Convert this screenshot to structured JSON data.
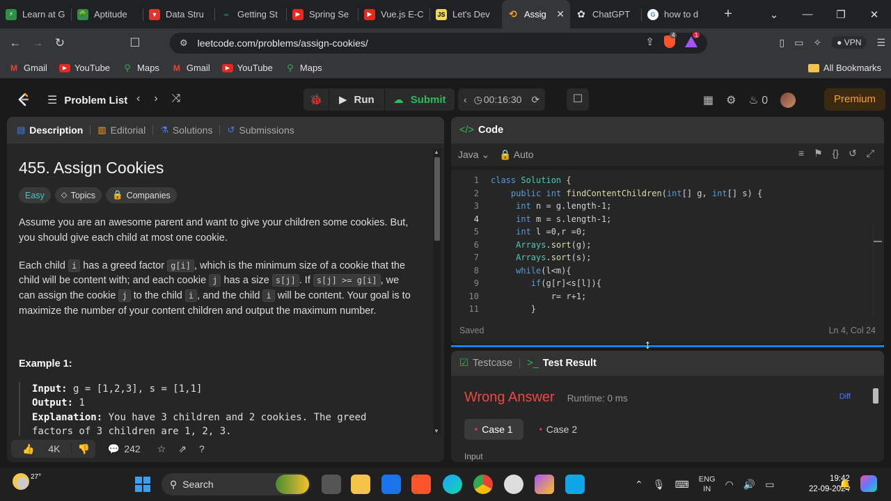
{
  "browser": {
    "tabs": [
      {
        "title": "Learn at G",
        "color": "#2f8f46"
      },
      {
        "title": "Aptitude",
        "color": "#2f8f46"
      },
      {
        "title": "Data Stru",
        "color": "#e2322c"
      },
      {
        "title": "Getting St",
        "color": "#2f8f46"
      },
      {
        "title": "Spring Se",
        "color": "#e8281e"
      },
      {
        "title": "Vue.js E-C",
        "color": "#e8281e"
      },
      {
        "title": "Let's Dev",
        "color": "#f0db4f"
      },
      {
        "title": "Assig",
        "color": "#ffa116",
        "active": true
      },
      {
        "title": "ChatGPT",
        "color": "#ffffff"
      },
      {
        "title": "how to d",
        "color": "#4285f4"
      }
    ],
    "url": "leetcode.com/problems/assign-cookies/",
    "brave_badge": "4",
    "rewards_badge": "1",
    "vpn_label": "VPN",
    "bookmarks": [
      {
        "label": "Gmail",
        "icon": "gmail-icon"
      },
      {
        "label": "YouTube",
        "icon": "youtube-icon"
      },
      {
        "label": "Maps",
        "icon": "maps-icon"
      },
      {
        "label": "Gmail",
        "icon": "gmail-icon"
      },
      {
        "label": "YouTube",
        "icon": "youtube-icon"
      },
      {
        "label": "Maps",
        "icon": "maps-icon"
      }
    ],
    "all_bookmarks": "All Bookmarks"
  },
  "lc_header": {
    "problem_list": "Problem List",
    "run": "Run",
    "submit": "Submit",
    "timer": "00:16:30",
    "streak": "0",
    "premium": "Premium"
  },
  "description": {
    "tabs": [
      "Description",
      "Editorial",
      "Solutions",
      "Submissions"
    ],
    "title": "455. Assign Cookies",
    "tags": [
      "Easy",
      "Topics",
      "Companies"
    ],
    "para1": "Assume you are an awesome parent and want to give your children some cookies. But, you should give each child at most one cookie.",
    "p2": {
      "t1": "Each child ",
      "c1": "i",
      "t2": " has a greed factor ",
      "c2": "g[i]",
      "t3": ", which is the minimum size of a cookie that the child will be content with; and each cookie ",
      "c3": "j",
      "t4": " has a size ",
      "c4": "s[j]",
      "t5": ". If ",
      "c5": "s[j] >= g[i]",
      "t6": ", we can assign the cookie ",
      "c6": "j",
      "t7": " to the child ",
      "c7": "i",
      "t8": ", and the child ",
      "c8": "i",
      "t9": " will be content. Your goal is to maximize the number of your content children and output the maximum number."
    },
    "example_title": "Example 1:",
    "example": {
      "input_label": "Input:",
      "input": " g = [1,2,3], s = [1,1]",
      "output_label": "Output:",
      "output": " 1",
      "explanation_label": "Explanation:",
      "explanation": " You have 3 children and 2 cookies. The greed",
      "cut_line": "factors of 3 children are 1, 2, 3."
    },
    "footer": {
      "likes": "4K",
      "comments": "242"
    }
  },
  "code": {
    "header": "Code",
    "language": "Java",
    "mode": "Auto",
    "lines": [
      "class Solution {",
      "    public int findContentChildren(int[] g, int[] s) {",
      "     int n = g.length-1;",
      "     int m = s.length-1;",
      "     int l =0,r =0;",
      "     Arrays.sort(g);",
      "     Arrays.sort(s);",
      "     while(l<m){",
      "        if(g[r]<s[l]){",
      "            r= r+1;",
      "        }"
    ],
    "line_numbers": [
      "1",
      "2",
      "3",
      "4",
      "5",
      "6",
      "7",
      "8",
      "9",
      "10",
      "11"
    ],
    "status": "Saved",
    "cursor": "Ln 4, Col 24"
  },
  "test": {
    "tabs": [
      "Testcase",
      "Test Result"
    ],
    "verdict": "Wrong Answer",
    "runtime": "Runtime: 0 ms",
    "diff": "Diff",
    "cases": [
      "Case 1",
      "Case 2"
    ],
    "input_label": "Input"
  },
  "taskbar": {
    "temp": "27°",
    "search": "Search",
    "lang1": "ENG",
    "lang2": "IN",
    "time": "19:42",
    "date": "22-09-2024"
  }
}
